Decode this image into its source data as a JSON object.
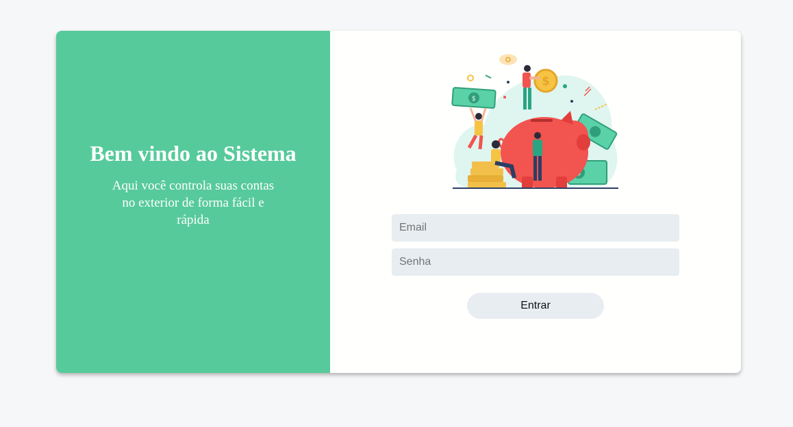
{
  "welcome": {
    "title": "Bem vindo ao Sistema",
    "subtitle": "Aqui você controla suas contas no exterior de forma fácil e rápida"
  },
  "form": {
    "email_placeholder": "Email",
    "password_placeholder": "Senha",
    "submit_label": "Entrar"
  },
  "colors": {
    "accent": "#57ca9b",
    "input_bg": "#e8edf1",
    "page_bg": "#f6f7f8"
  },
  "icons": [
    "piggy-bank-illustration",
    "dollar-coin-icon",
    "banknote-icon"
  ]
}
